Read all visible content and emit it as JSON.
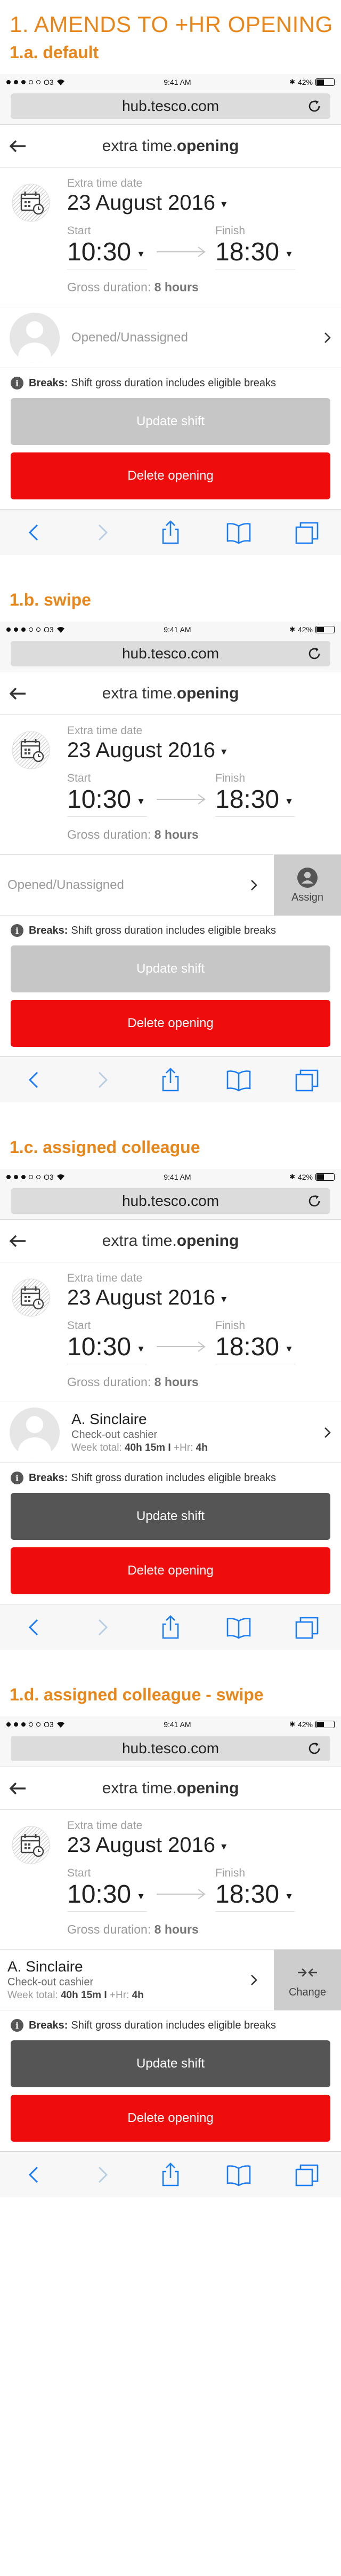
{
  "main_title": "1. AMENDS TO +HR OPENING",
  "status_bar": {
    "carrier": "O3",
    "time": "9:41 AM",
    "battery": "42%"
  },
  "browser": {
    "url": "hub.tesco.com"
  },
  "app": {
    "title_light": "extra time.",
    "title_bold": "opening"
  },
  "shift": {
    "date_label": "Extra time date",
    "date": "23 August 2016",
    "start_label": "Start",
    "start": "10:30",
    "finish_label": "Finish",
    "finish": "18:30",
    "gross_label": "Gross duration:",
    "gross_value": "8 hours"
  },
  "breaks": {
    "label": "Breaks:",
    "text": "Shift gross duration includes eligible breaks"
  },
  "buttons": {
    "update": "Update shift",
    "delete": "Delete opening",
    "assign": "Assign",
    "change": "Change"
  },
  "unassigned": "Opened/Unassigned",
  "colleague": {
    "name": "A. Sinclaire",
    "role": "Check-out cashier",
    "week_label": "Week total:",
    "week_value": "40h 15m",
    "sep": "I",
    "hr_label": "+Hr:",
    "hr_value": "4h"
  },
  "sections": [
    {
      "title": "1.a. default"
    },
    {
      "title": "1.b. swipe"
    },
    {
      "title": "1.c. assigned colleague"
    },
    {
      "title": "1.d. assigned colleague - swipe"
    }
  ],
  "colors": {
    "accent": "#e8861a",
    "delete": "#ef0c0c",
    "update_disabled": "#c6c6c6",
    "update_active": "#555555",
    "ios_blue": "#1a7cf5"
  },
  "icons": [
    "calendar-clock-icon",
    "back-arrow-icon",
    "reload-icon",
    "chevron-right-icon",
    "info-icon",
    "person-icon",
    "swap-arrows-icon",
    "safari-back-icon",
    "safari-forward-icon",
    "share-icon",
    "bookmarks-icon",
    "tabs-icon"
  ]
}
